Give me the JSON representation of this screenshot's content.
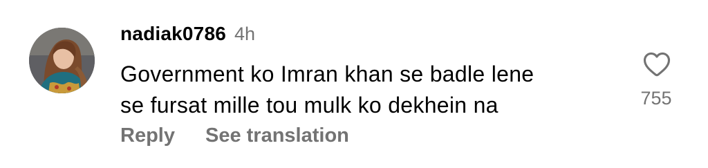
{
  "comment": {
    "username": "nadiak0786",
    "time_ago": "4h",
    "text_lines": [
      "Government ko Imran khan se badle lene",
      "se fursat mille tou mulk ko dekhein na"
    ],
    "actions": {
      "reply_label": "Reply",
      "translate_label": "See translation"
    },
    "like": {
      "icon": "heart-outline-icon",
      "count": "755"
    }
  },
  "colors": {
    "text_primary": "#000000",
    "text_secondary": "#737373",
    "background": "#ffffff"
  }
}
